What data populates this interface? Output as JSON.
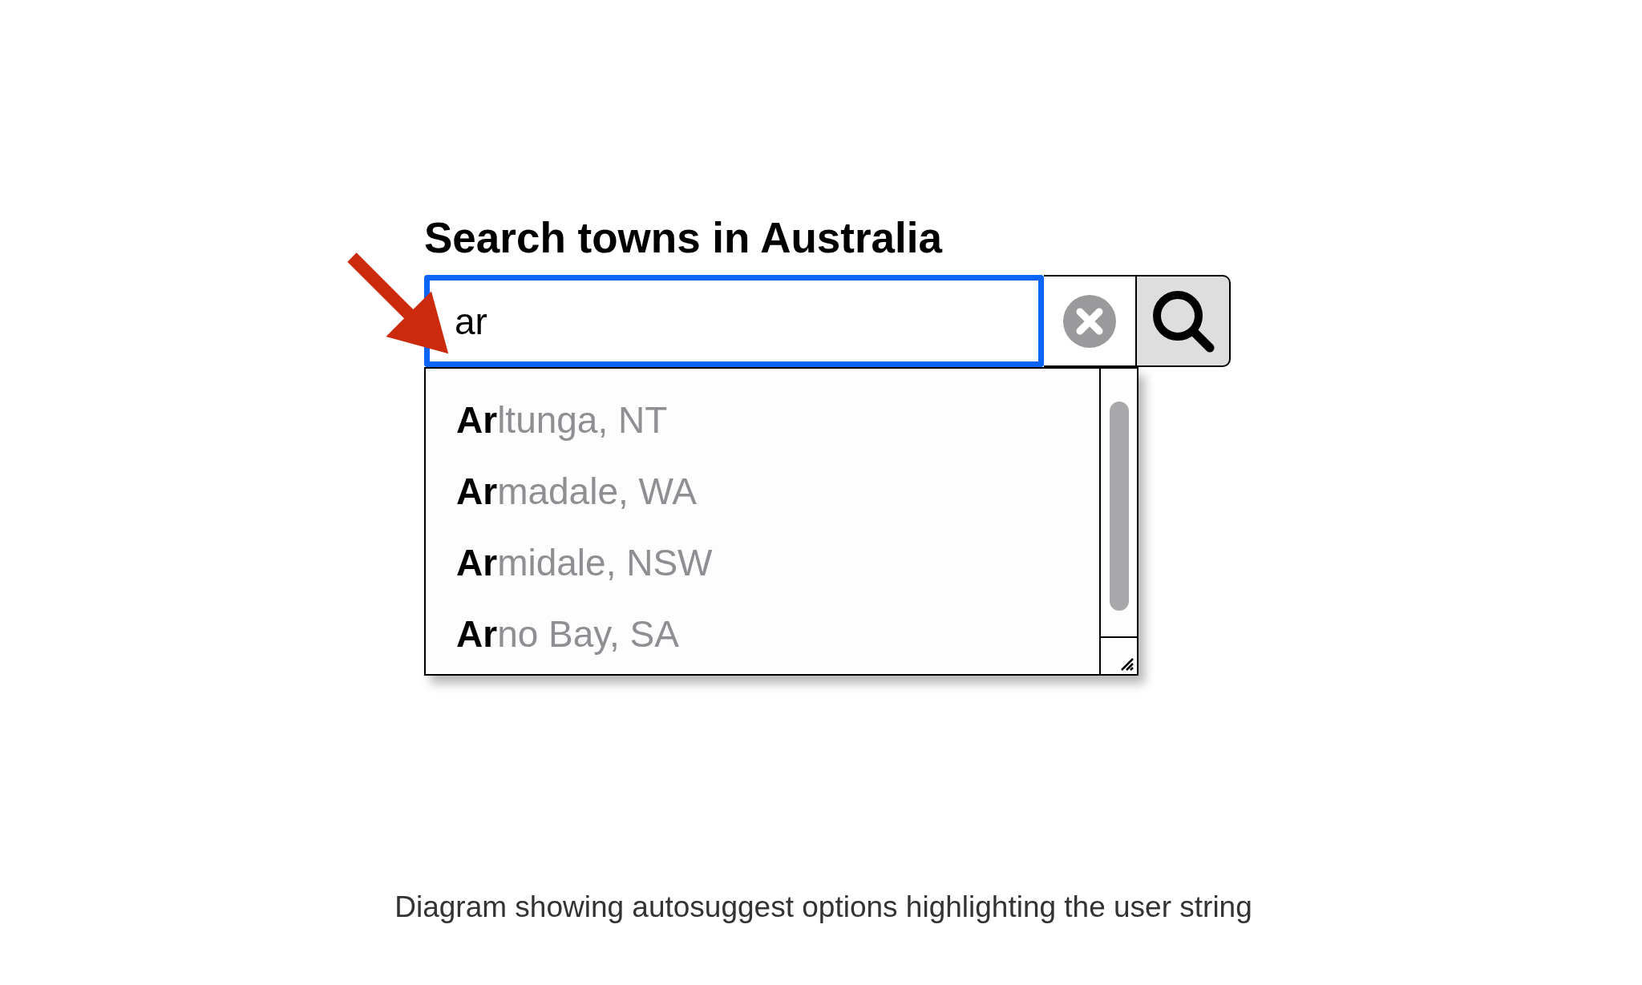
{
  "heading": "Search towns in Australia",
  "search": {
    "value": "ar",
    "focused": true
  },
  "suggestions": [
    "**Ar**ltunga, NT",
    "**Ar**madale, WA",
    "**Ar**midale, NSW",
    "**Ar**no Bay, SA"
  ],
  "caption": "Diagram showing autosuggest options highlighting the user string"
}
